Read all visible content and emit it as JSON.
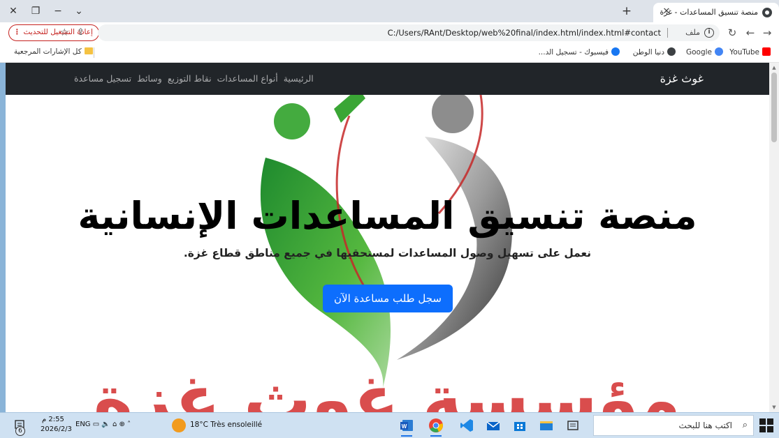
{
  "browser": {
    "tab_title": "منصة تنسيق المساعدات - غزة",
    "url": "C:/Users/RAnt/Desktop/web%20final/index.html/index.html#contact",
    "file_chip": "ملف",
    "reload_update_label": "إعادة التشغيل للتحديث",
    "profile_initial": "ع",
    "bookmarks": [
      {
        "label": "YouTube",
        "icon": "youtube-icon",
        "color": "#ff0000"
      },
      {
        "label": "Google",
        "icon": "google-icon",
        "color": "#4285f4"
      },
      {
        "label": "دنيا الوطن",
        "icon": "globe-icon",
        "color": "#3c4043"
      },
      {
        "label": "فيسبوك - تسجيل الد...",
        "icon": "facebook-icon",
        "color": "#1877f2"
      }
    ],
    "all_bookmarks_label": "كل الإشارات المرجعية"
  },
  "site": {
    "brand": "غوث غزة",
    "nav": [
      "الرئيسية",
      "أنواع المساعدات",
      "نقاط التوزيع",
      "وسائط",
      "تسجيل مساعدة"
    ],
    "hero_title": "منصة تنسيق المساعدات الإنسانية",
    "hero_subtitle": "نعمل على تسهيل وصول المساعدات لمستحقيها في جميع مناطق قطاع غزة.",
    "cta_label": "سجل طلب مساعدة الآن",
    "watermark_text": "مؤسسة غوث غزة",
    "colors": {
      "navbar": "#212529",
      "cta": "#0d6efd",
      "logo_green": "#3aa635",
      "logo_red": "#c62828"
    }
  },
  "taskbar": {
    "search_placeholder": "اكتب هنا للبحث",
    "weather": "18°C  Très ensoleillé",
    "tray": "ENG",
    "time": "2:55 م",
    "date": "2026/2/3",
    "notification_count": "6"
  }
}
